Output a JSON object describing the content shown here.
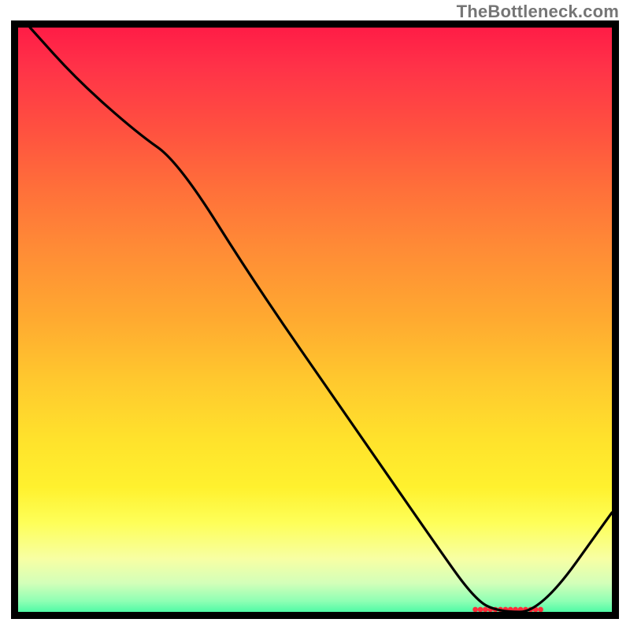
{
  "attribution": "TheBottleneck.com",
  "chart_data": {
    "type": "line",
    "title": "",
    "xlabel": "",
    "ylabel": "",
    "xlim": [
      0,
      100
    ],
    "ylim": [
      0,
      100
    ],
    "grid": false,
    "legend": false,
    "series": [
      {
        "name": "curve",
        "x": [
          2,
          10,
          20,
          27,
          40,
          55,
          70,
          77,
          81,
          88,
          100
        ],
        "values": [
          100,
          91,
          82,
          77,
          56,
          34,
          12,
          2,
          0,
          0,
          17
        ]
      }
    ],
    "marker_segment": {
      "x_start": 77,
      "x_end": 88,
      "y": 0
    },
    "background_gradient": {
      "top_color": "#ff1846",
      "mid_color": "#ffe22c",
      "bottom_color": "#27f79d"
    }
  }
}
